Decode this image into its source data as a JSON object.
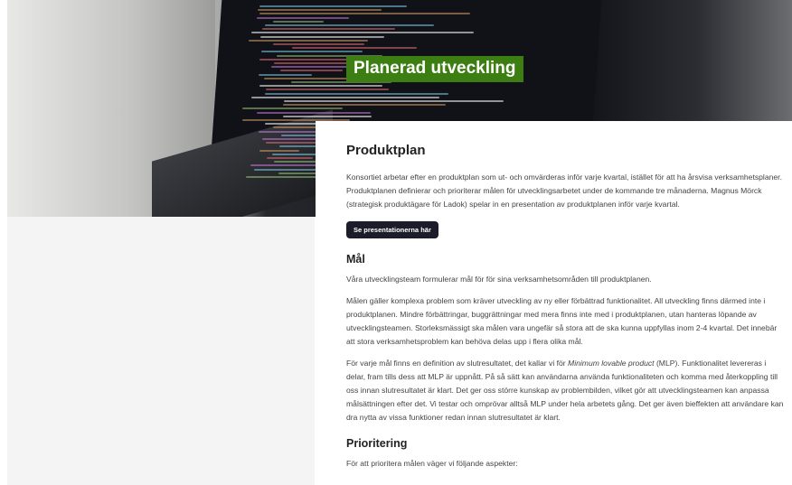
{
  "hero": {
    "title": "Planerad utveckling"
  },
  "section_productplan": {
    "heading": "Produktplan",
    "paragraph": "Konsortiet arbetar efter en produktplan som ut- och omvärderas inför varje kvartal, istället för att ha årsvisa verksamhetsplaner. Produktplanen definierar och prioriterar målen för utvecklingsarbetet under de kommande tre månaderna. Magnus Mörck (strategisk produktägare för Ladok) spelar in en presentation av produktplanen inför varje kvartal.",
    "button_label": "Se presentationerna här"
  },
  "section_goals": {
    "heading": "Mål",
    "paragraph1": "Våra utvecklingsteam formulerar mål för för sina verksamhetsområden till produktplanen.",
    "paragraph2": "Målen gäller komplexa problem som kräver utveckling av ny eller förbättrad funktionalitet. All utveckling finns därmed inte i produktplanen. Mindre förbättringar, buggrättningar med mera finns inte med i produktplanen, utan hanteras löpande av utvecklingsteamen. Storleksmässigt ska målen vara ungefär så stora att de ska kunna uppfyllas inom 2-4 kvartal. Det innebär att stora verksamhetsproblem kan behöva delas upp i flera olika mål.",
    "paragraph3_before": "För varje mål finns en definition av slutresultatet, det kallar vi för ",
    "paragraph3_em": "Minimum lovable product",
    "paragraph3_after": " (MLP). Funktionalitet levereras i delar, fram tills dess att MLP är uppnått. På så sätt kan användarna använda funktionaliteten och komma med återkoppling till oss innan slutresultatet är klart. Det ger oss större kunskap av problembilden, vilket gör att utvecklingsteamen kan anpassa målsättningen efter det. Vi testar och omprövar alltså MLP under hela arbetets gång. Det ger även bieffekten att användare kan dra nytta av vissa funktioner redan innan slutresultatet är klart."
  },
  "section_priority": {
    "heading": "Prioritering",
    "paragraph": "För att prioritera målen väger vi följande aspekter:"
  },
  "colors": {
    "title_badge_bg": "#3c7e11",
    "button_bg": "#1c1c2a",
    "left_panel_bg": "#f4f4f4"
  }
}
